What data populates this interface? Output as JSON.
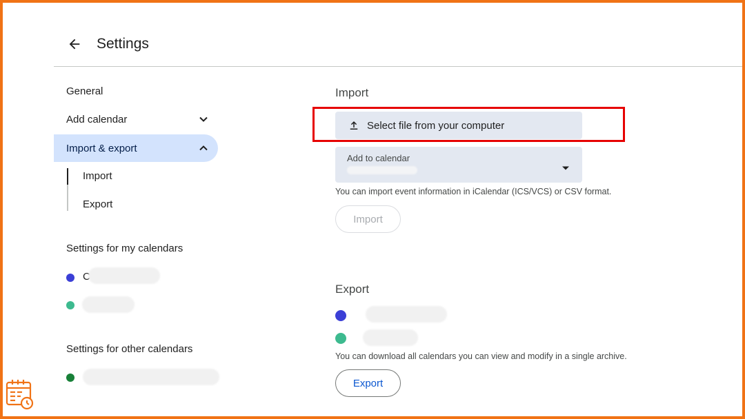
{
  "header": {
    "title": "Settings",
    "back_icon": "arrow-back-icon"
  },
  "sidebar": {
    "items": [
      {
        "label": "General"
      },
      {
        "label": "Add calendar",
        "icon": "chevron-down-icon"
      },
      {
        "label": "Import & export",
        "icon": "chevron-up-icon",
        "active": true
      }
    ],
    "subitems": [
      {
        "label": "Import",
        "active": true
      },
      {
        "label": "Export"
      }
    ],
    "my_calendars": {
      "title": "Settings for my calendars",
      "items": [
        {
          "visible_letter": "C",
          "color": "#3b3fd6"
        },
        {
          "visible_letter": "",
          "color": "#3dba8f"
        }
      ]
    },
    "other_calendars": {
      "title": "Settings for other calendars",
      "items": [
        {
          "color": "#188038"
        }
      ]
    }
  },
  "import": {
    "title": "Import",
    "select_file_label": "Select file from your computer",
    "select_file_icon": "upload-icon",
    "add_to_calendar_label": "Add to calendar",
    "help_text": "You can import event information in iCalendar (ICS/VCS) or CSV format.",
    "import_button": "Import"
  },
  "export": {
    "title": "Export",
    "calendars": [
      {
        "color": "#3b3fd6"
      },
      {
        "color": "#3dba8f"
      }
    ],
    "help_text": "You can download all calendars you can view and modify in a single archive.",
    "export_button": "Export"
  },
  "colors": {
    "accent": "#0b57d0",
    "active_nav": "#d3e3fd",
    "highlight": "#e60000",
    "frame": "#f07316"
  },
  "logo": {
    "icon": "calendar-logo-icon"
  }
}
